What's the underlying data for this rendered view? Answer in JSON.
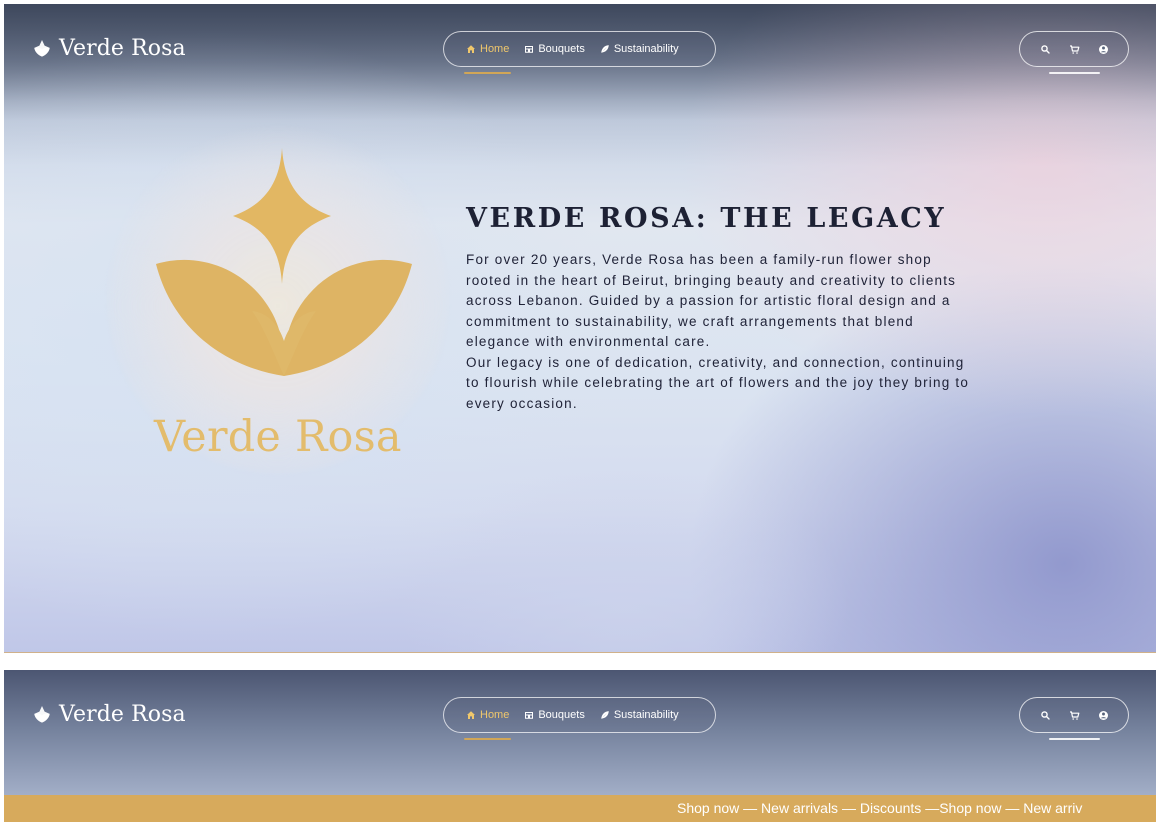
{
  "brand": {
    "name": "Verde Rosa"
  },
  "nav": {
    "items": [
      {
        "label": "Home",
        "icon": "home-icon"
      },
      {
        "label": "Bouquets",
        "icon": "bouquet-icon"
      },
      {
        "label": "Sustainability",
        "icon": "leaf-icon"
      }
    ],
    "active": "Home"
  },
  "utilities": {
    "icons": [
      "search-icon",
      "cart-icon",
      "user-icon"
    ]
  },
  "hero": {
    "logo_text": "Verde Rosa",
    "title": "VERDE ROSA: THE LEGACY",
    "paragraph_1": "For over 20 years, Verde Rosa has been a family-run flower shop rooted in the heart of Beirut, bringing beauty and creativity to clients across Lebanon. Guided by a passion for artistic floral design and a commitment to sustainability, we craft arrangements that blend elegance with environmental care.",
    "paragraph_2": "Our legacy is one of dedication, creativity, and connection, continuing to flourish while celebrating the art of flowers and the joy they bring to every occasion."
  },
  "promo": {
    "text": "Shop now — New arrivals — Discounts —Shop now — New arriv"
  },
  "colors": {
    "accent": "#D7AA5C",
    "logo_gold": "#E3BC6C",
    "text_dark": "#202338"
  }
}
